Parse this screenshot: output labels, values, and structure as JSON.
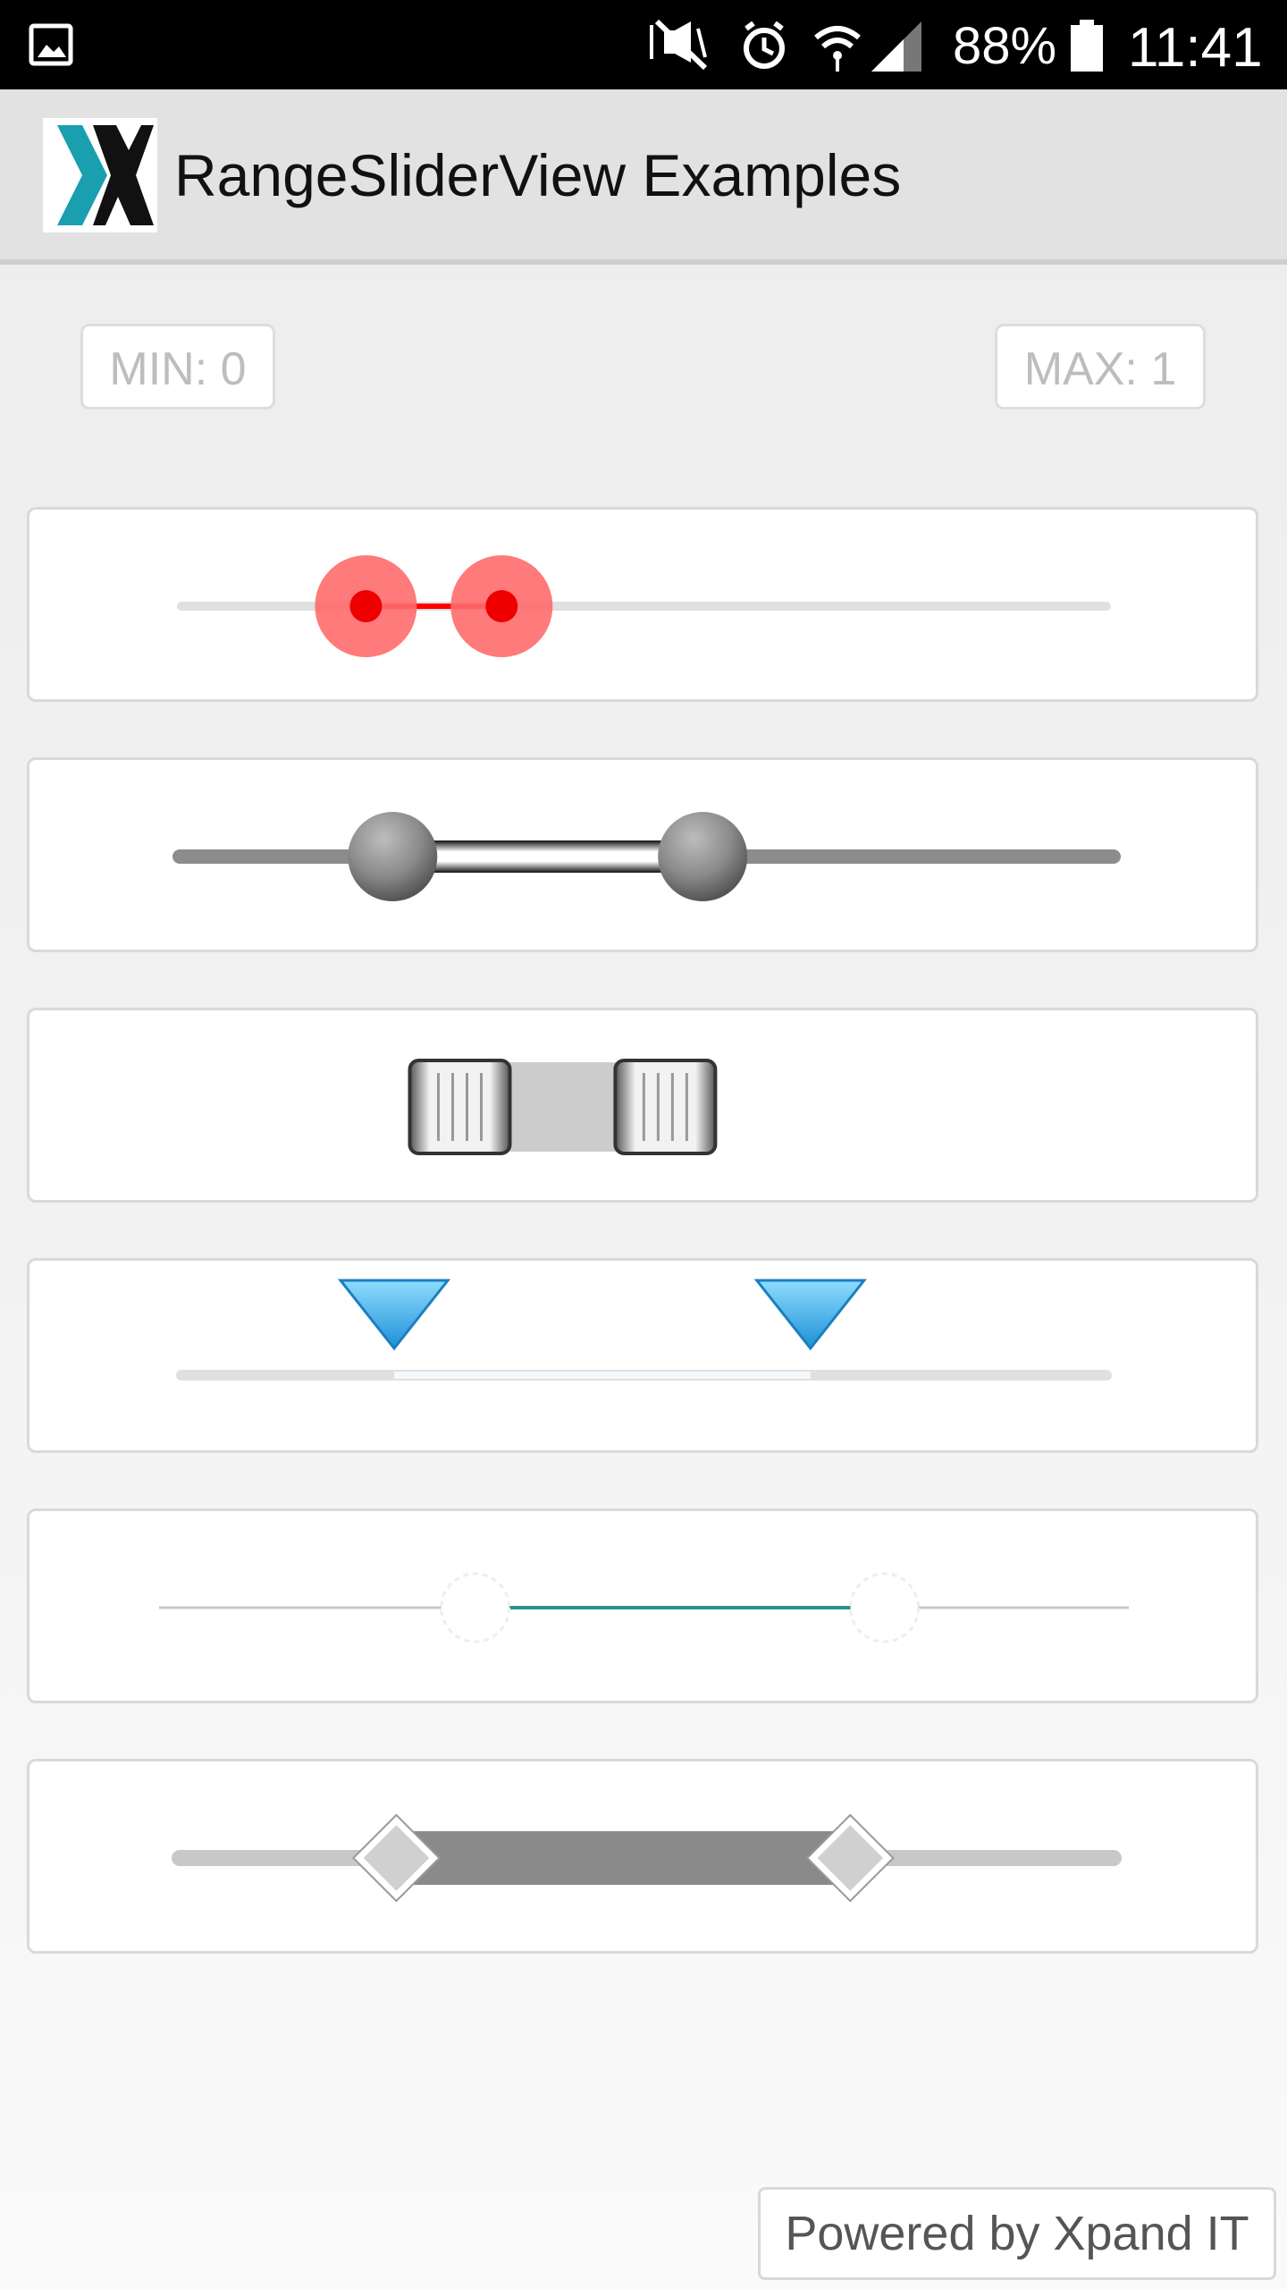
{
  "status_bar": {
    "battery_percent": "88%",
    "time": "11:41",
    "icons": [
      "gallery-icon",
      "mute-vibrate-icon",
      "alarm-icon",
      "wifi-icon",
      "signal-icon",
      "battery-icon"
    ]
  },
  "app_bar": {
    "title": "RangeSliderView Examples",
    "logo_icon": "xpand-logo-icon"
  },
  "range": {
    "min_label": "MIN: 0",
    "max_label": "MAX: 1"
  },
  "sliders": [
    {
      "style": "red-dots",
      "start": 0.18,
      "end": 0.335,
      "accent": "#ff0000"
    },
    {
      "style": "metal-knobs",
      "start": 0.228,
      "end": 0.56,
      "accent": "#8a8a8a"
    },
    {
      "style": "square-handles",
      "start": 0.3,
      "end": 0.52,
      "accent": "#cccccc"
    },
    {
      "style": "blue-triangles",
      "start": 0.23,
      "end": 0.68,
      "accent": "#1e9ee0"
    },
    {
      "style": "thin-line",
      "start": 0.326,
      "end": 0.748,
      "accent": "#2a8f91"
    },
    {
      "style": "diamonds",
      "start": 0.232,
      "end": 0.718,
      "accent": "#8a8a8a"
    }
  ],
  "footer": {
    "powered_by": "Powered by Xpand IT"
  }
}
